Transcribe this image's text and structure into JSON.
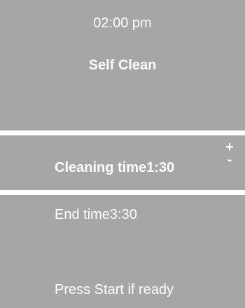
{
  "header": {
    "time": "02:00 pm",
    "mode": "Self Clean"
  },
  "cleaning": {
    "label": "Cleaning time1:30",
    "increase": "+",
    "decrease": "-"
  },
  "end": {
    "label": "End time3:30"
  },
  "footer": {
    "prompt": "Press Start if ready"
  },
  "colors": {
    "panel": "#a6a6a6",
    "text": "#ffffff",
    "divider": "#ffffff"
  }
}
